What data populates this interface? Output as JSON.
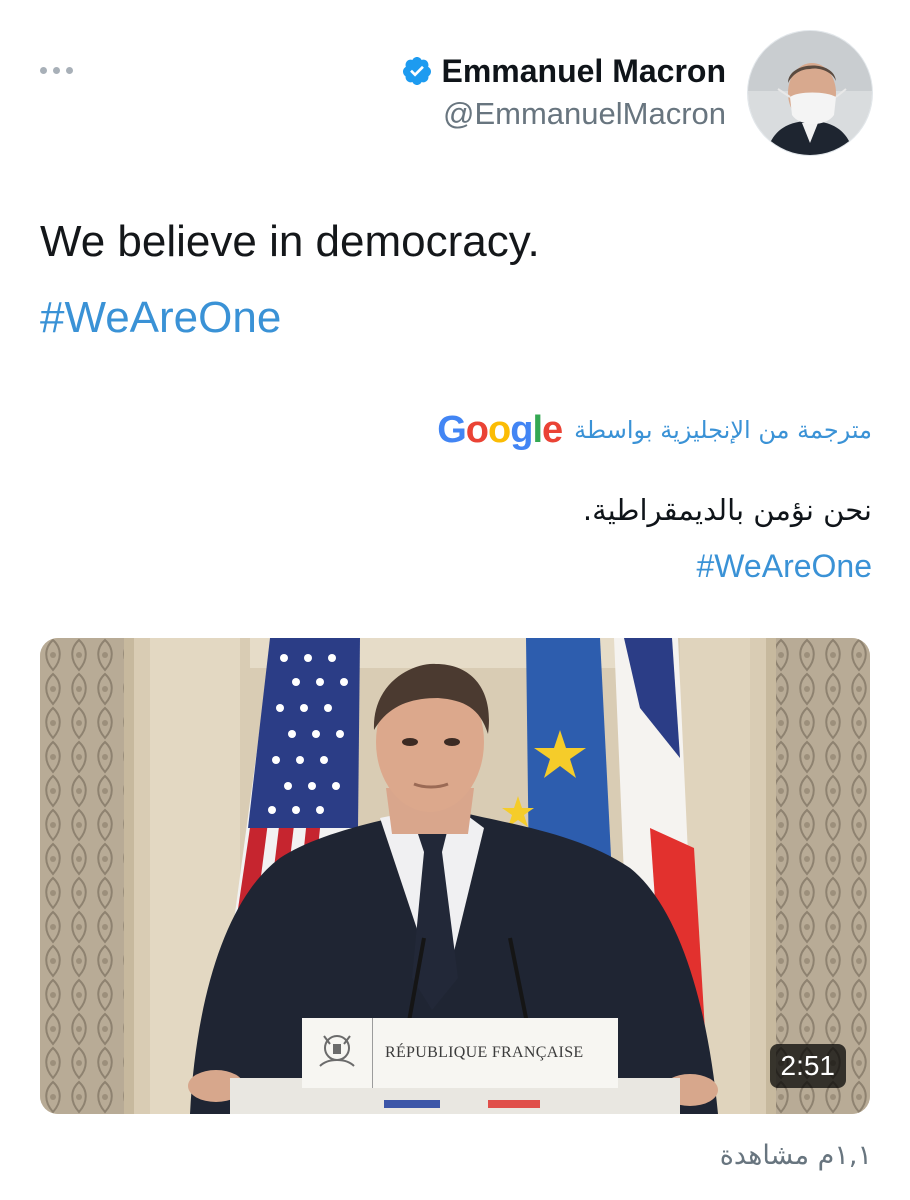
{
  "header": {
    "display_name": "Emmanuel Macron",
    "handle": "@EmmanuelMacron",
    "verified": true
  },
  "tweet": {
    "text": "We believe in democracy.",
    "hashtag": "#WeAreOne"
  },
  "translation": {
    "label": "مترجمة من الإنجليزية بواسطة",
    "provider": "Google",
    "text": "نحن نؤمن بالديمقراطية.",
    "hashtag": "#WeAreOne"
  },
  "video": {
    "lectern_label": "RÉPUBLIQUE FRANÇAISE",
    "duration": "2:51"
  },
  "stats": {
    "views": "١,١م مشاهدة"
  },
  "colors": {
    "link": "#3a92d6",
    "secondary_text": "#68757f",
    "verified_badge": "#1d9bf0"
  }
}
